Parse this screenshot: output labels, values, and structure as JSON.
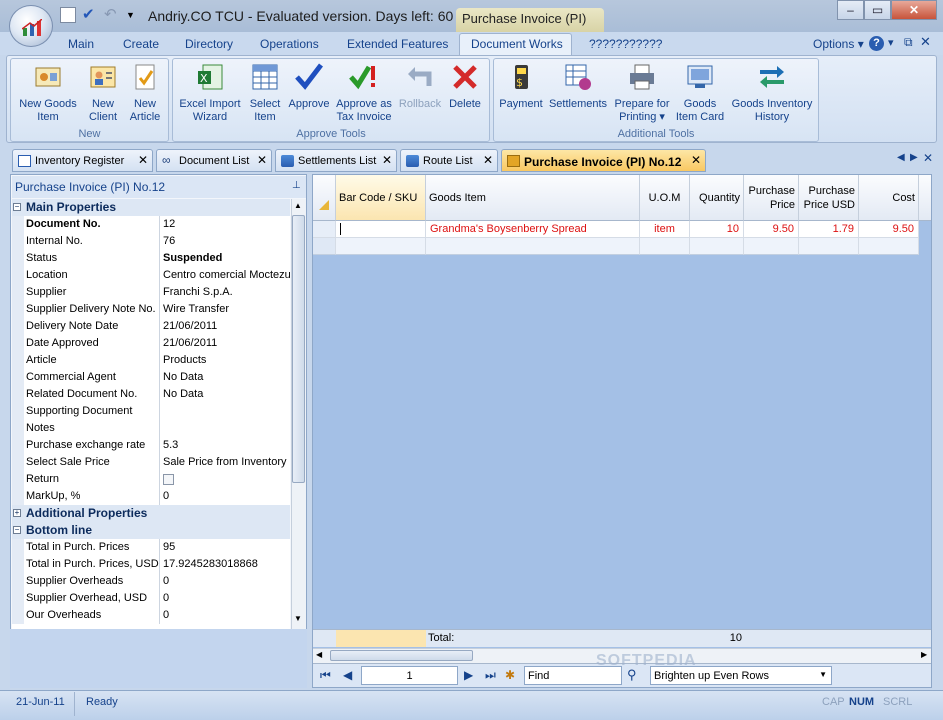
{
  "window": {
    "title": "Andriy.CO TCU - Evaluated version. Days left: 60 - [...",
    "context_tab": "Purchase Invoice (PI)",
    "options_label": "Options"
  },
  "menu": {
    "items": [
      "Main",
      "Create",
      "Directory",
      "Operations",
      "Extended Features",
      "Document Works",
      "???????????"
    ],
    "active": "Document Works"
  },
  "ribbon": {
    "groups": [
      {
        "title": "New",
        "buttons": [
          {
            "label1": "New Goods",
            "label2": "Item",
            "icon": "goods-item-icon"
          },
          {
            "label1": "New",
            "label2": "Client",
            "icon": "client-icon"
          },
          {
            "label1": "New",
            "label2": "Article",
            "icon": "article-icon"
          }
        ]
      },
      {
        "title": "Approve Tools",
        "buttons": [
          {
            "label1": "Excel Import",
            "label2": "Wizard",
            "icon": "excel-icon"
          },
          {
            "label1": "Select",
            "label2": "Item",
            "icon": "select-grid-icon"
          },
          {
            "label1": "Approve",
            "label2": "",
            "icon": "checkmark-icon"
          },
          {
            "label1": "Approve as",
            "label2": "Tax Invoice",
            "icon": "approve-tax-icon"
          },
          {
            "label1": "Rollback",
            "label2": "",
            "icon": "rollback-icon"
          },
          {
            "label1": "Delete",
            "label2": "",
            "icon": "delete-icon"
          }
        ]
      },
      {
        "title": "Additional Tools",
        "buttons": [
          {
            "label1": "Payment",
            "label2": "",
            "icon": "payment-icon"
          },
          {
            "label1": "Settlements",
            "label2": "",
            "icon": "settlements-icon"
          },
          {
            "label1": "Prepare for",
            "label2": "Printing ▾",
            "icon": "printer-icon"
          },
          {
            "label1": "Goods",
            "label2": "Item Card",
            "icon": "item-card-icon"
          },
          {
            "label1": "Goods Inventory",
            "label2": "History",
            "icon": "history-arrows-icon"
          }
        ]
      }
    ]
  },
  "doc_tabs": [
    {
      "label": "Inventory Register"
    },
    {
      "label": "Document List"
    },
    {
      "label": "Settlements List"
    },
    {
      "label": "Route List"
    },
    {
      "label": "Purchase Invoice (PI) No.12"
    }
  ],
  "properties": {
    "header": "Purchase Invoice (PI) No.12",
    "main_title": "Main Properties",
    "main": [
      {
        "key": "Document No.",
        "value": "12"
      },
      {
        "key": "Internal No.",
        "value": "76"
      },
      {
        "key": "Status",
        "value": "Suspended"
      },
      {
        "key": "Location",
        "value": "Centro comercial Moctezuma"
      },
      {
        "key": "Supplier",
        "value": "Franchi S.p.A."
      },
      {
        "key": "Supplier Delivery Note No.",
        "value": "Wire Transfer"
      },
      {
        "key": "Delivery Note Date",
        "value": "21/06/2011"
      },
      {
        "key": "Date Approved",
        "value": "21/06/2011"
      },
      {
        "key": "Article",
        "value": "Products"
      },
      {
        "key": "Commercial Agent",
        "value": "No Data"
      },
      {
        "key": "Related Document No.",
        "value": "No Data"
      },
      {
        "key": "Supporting Document",
        "value": ""
      },
      {
        "key": "Notes",
        "value": ""
      },
      {
        "key": "Purchase exchange rate",
        "value": "5.3"
      },
      {
        "key": "Select Sale Price",
        "value": "Sale Price from Inventory F"
      },
      {
        "key": "Return",
        "value": ""
      },
      {
        "key": "MarkUp, %",
        "value": "0"
      }
    ],
    "additional_title": "Additional Properties",
    "bottom_title": "Bottom line",
    "bottom": [
      {
        "key": "Total in Purch. Prices",
        "value": "95"
      },
      {
        "key": "Total in Purch. Prices, USD",
        "value": "17.9245283018868"
      },
      {
        "key": "Supplier Overheads",
        "value": "0"
      },
      {
        "key": "Supplier Overhead, USD",
        "value": "0"
      },
      {
        "key": "Our Overheads",
        "value": "0"
      }
    ]
  },
  "grid": {
    "columns": [
      "Bar Code / SKU",
      "Goods Item",
      "U.O.M",
      "Quantity",
      "Purchase Price",
      "Purchase Price USD",
      "Cost"
    ],
    "rows": [
      {
        "sku": "",
        "item": "Grandma's Boysenberry Spread",
        "uom": "item",
        "qty": "10",
        "price": "9.50",
        "price_usd": "1.79",
        "cost": "9.50"
      }
    ],
    "total_label": "Total:",
    "total_qty": "10"
  },
  "navigator": {
    "page": "1",
    "find_placeholder": "Find",
    "highlight_option": "Brighten up Even Rows"
  },
  "status": {
    "date": "21-Jun-11",
    "state": "Ready",
    "caps": "CAP",
    "num": "NUM",
    "scroll": "SCRL"
  },
  "watermark": "SOFTPEDIA"
}
